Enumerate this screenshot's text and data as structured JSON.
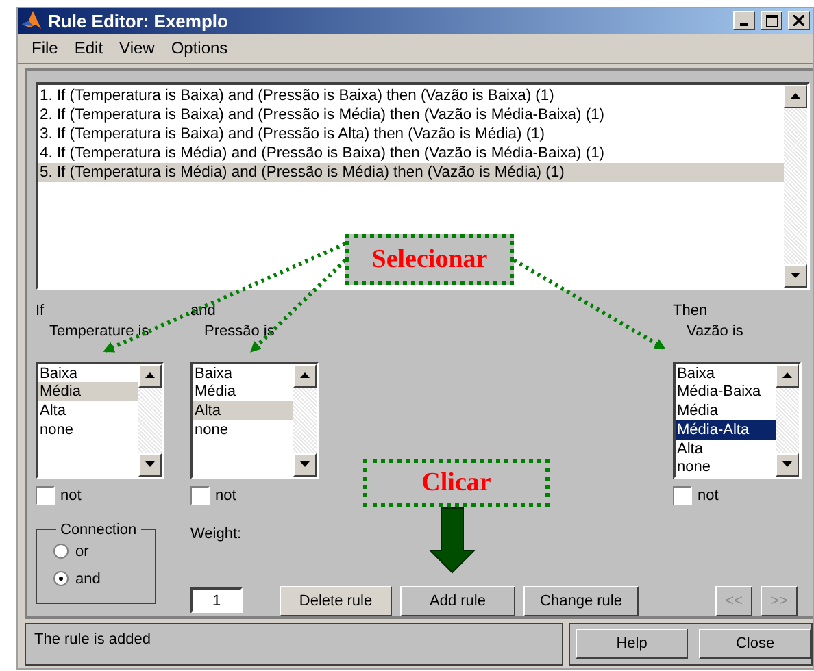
{
  "window": {
    "title": "Rule Editor: Exemplo"
  },
  "menu": [
    "File",
    "Edit",
    "View",
    "Options"
  ],
  "rules": [
    {
      "text": "1. If (Temperatura is Baixa) and (Pressão is Baixa) then (Vazão is Baixa) (1)",
      "selected": false
    },
    {
      "text": "2. If (Temperatura is Baixa) and (Pressão is Média) then (Vazão is Média-Baixa) (1)",
      "selected": false
    },
    {
      "text": "3. If (Temperatura is Baixa) and (Pressão is Alta) then (Vazão is Média) (1)",
      "selected": false
    },
    {
      "text": "4. If (Temperatura is Média) and (Pressão is Baixa) then (Vazão is Média-Baixa) (1)",
      "selected": false
    },
    {
      "text": "5. If (Temperatura is Média) and (Pressão is Média) then (Vazão is Média) (1)",
      "selected": true
    }
  ],
  "variables": [
    {
      "kind": "input",
      "connector": "If",
      "label": "Temperature is",
      "not_label": "not",
      "not_checked": false,
      "options": [
        {
          "label": "Baixa",
          "selected": false
        },
        {
          "label": "Média",
          "selected": true
        },
        {
          "label": "Alta",
          "selected": false
        },
        {
          "label": "none",
          "selected": false
        }
      ]
    },
    {
      "kind": "input",
      "connector": "and",
      "label": "Pressão is",
      "not_label": "not",
      "not_checked": false,
      "options": [
        {
          "label": "Baixa",
          "selected": false
        },
        {
          "label": "Média",
          "selected": false
        },
        {
          "label": "Alta",
          "selected": true
        },
        {
          "label": "none",
          "selected": false
        }
      ]
    },
    {
      "kind": "output",
      "connector": "Then",
      "label": "Vazão is",
      "not_label": "not",
      "not_checked": false,
      "options": [
        {
          "label": "Baixa",
          "selected": false
        },
        {
          "label": "Média-Baixa",
          "selected": false
        },
        {
          "label": "Média",
          "selected": false
        },
        {
          "label": "Média-Alta",
          "selected": true
        },
        {
          "label": "Alta",
          "selected": false
        },
        {
          "label": "none",
          "selected": false
        }
      ]
    }
  ],
  "connection": {
    "title": "Connection",
    "options": [
      {
        "label": "or",
        "selected": false
      },
      {
        "label": "and",
        "selected": true
      }
    ]
  },
  "weight": {
    "label": "Weight:",
    "value": "1"
  },
  "rule_buttons": [
    {
      "label": "Delete rule",
      "focused": true
    },
    {
      "label": "Add rule",
      "focused": false
    },
    {
      "label": "Change rule",
      "focused": false
    }
  ],
  "nav_buttons": [
    {
      "label": "<<",
      "disabled": true
    },
    {
      "label": ">>",
      "disabled": true
    }
  ],
  "status": "The rule is added",
  "footer_buttons": [
    "Help",
    "Close"
  ],
  "annotations": [
    {
      "kind": "select",
      "text": "Selecionar"
    },
    {
      "kind": "click",
      "text": "Clicar"
    }
  ]
}
